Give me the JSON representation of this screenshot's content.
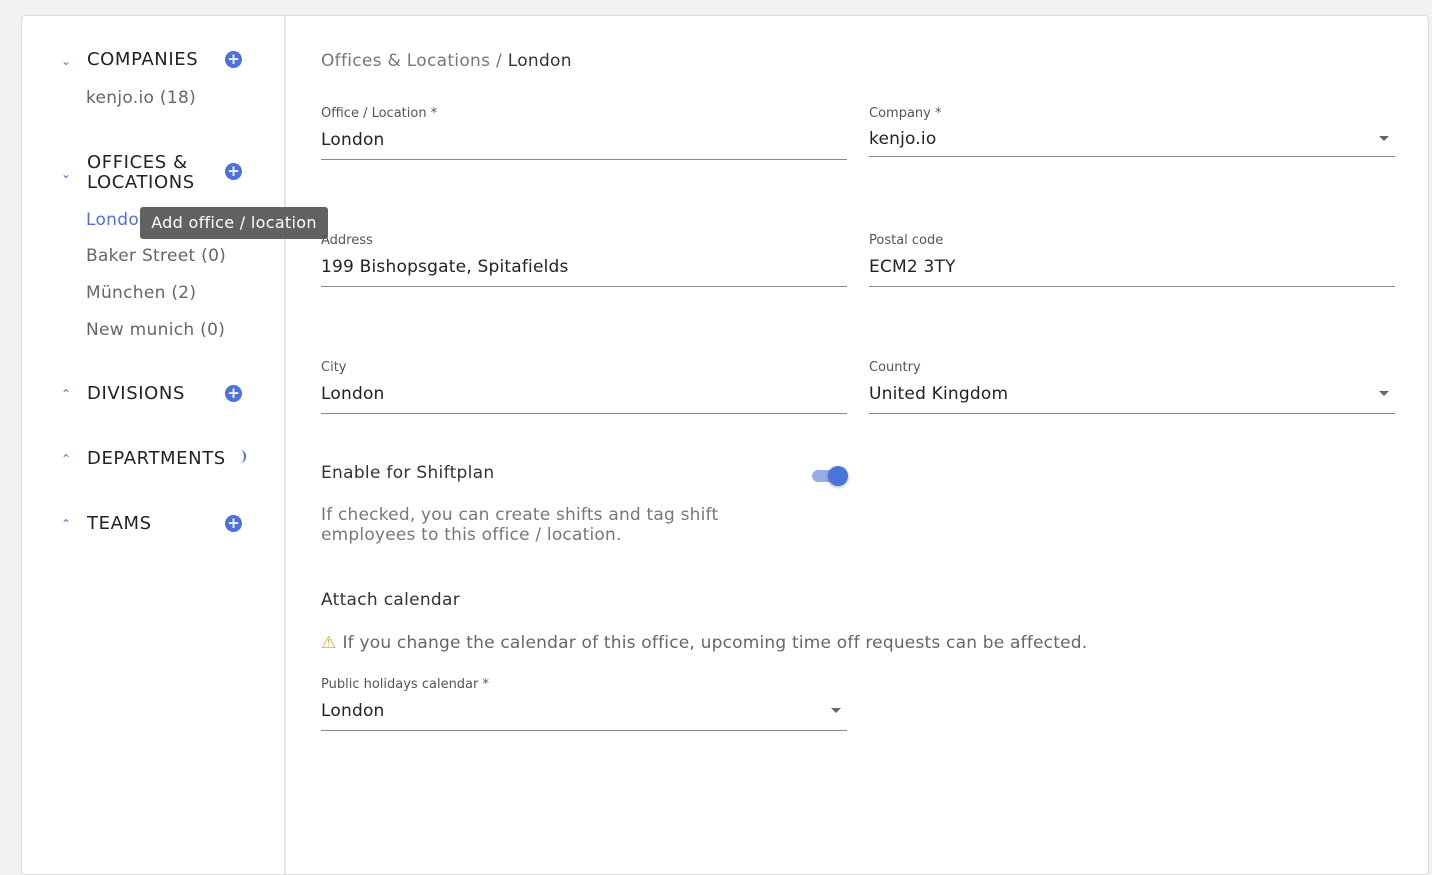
{
  "sidebar": {
    "sections": {
      "companies": {
        "title": "COMPANIES",
        "items": [
          "kenjo.io (18)"
        ]
      },
      "offices": {
        "title_line1": "OFFICES &",
        "title_line2": "LOCATIONS",
        "items": [
          "London",
          "Baker Street (0)",
          "München (2)",
          "New munich (0)"
        ]
      },
      "divisions": {
        "title": "DIVISIONS"
      },
      "departments": {
        "title": "DEPARTMENTS"
      },
      "teams": {
        "title": "TEAMS"
      }
    },
    "tooltip": "Add office / location"
  },
  "breadcrumb": {
    "parent": "Offices & Locations /",
    "current": "London"
  },
  "form": {
    "office": {
      "label": "Office / Location *",
      "value": "London"
    },
    "company": {
      "label": "Company *",
      "value": "kenjo.io"
    },
    "address": {
      "label": "Address",
      "value": "199 Bishopsgate, Spitafields"
    },
    "postal": {
      "label": "Postal code",
      "value": "ECM2 3TY"
    },
    "city": {
      "label": "City",
      "value": "London"
    },
    "country": {
      "label": "Country",
      "value": "United Kingdom"
    },
    "shiftplan": {
      "label": "Enable for Shiftplan",
      "enabled": true,
      "hint": "If checked, you can create shifts and tag shift employees to this office / location."
    },
    "calendar": {
      "title": "Attach calendar",
      "warning": "If you change the calendar of this office, upcoming time off requests can be affected.",
      "label": "Public holidays calendar *",
      "value": "London"
    }
  },
  "colors": {
    "accent": "#4a74d9",
    "warning": "#e6a817"
  },
  "icons": {
    "collapse": "chevron-down-icon",
    "expand": "chevron-up-icon",
    "add": "plus-circle-icon",
    "warning": "warning-icon"
  }
}
